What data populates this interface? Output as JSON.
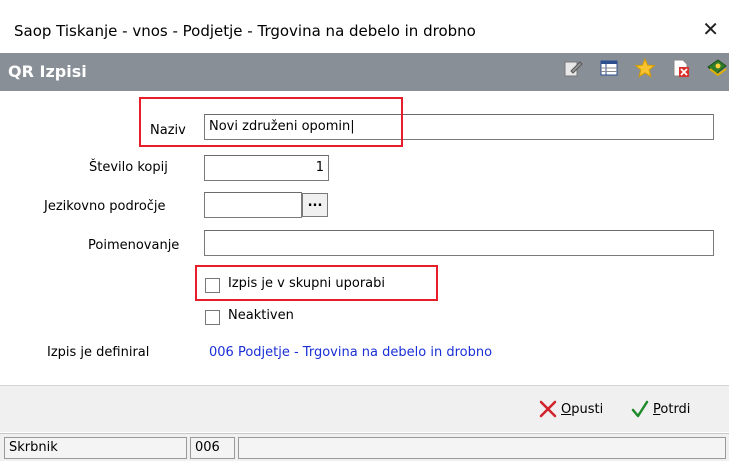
{
  "window": {
    "title": "Saop Tiskanje - vnos - Podjetje - Trgovina na debelo in drobno",
    "close_glyph": "✕"
  },
  "header": {
    "title": "QR Izpisi"
  },
  "toolbar": {
    "icons": [
      "edit-icon",
      "table-icon",
      "star-icon",
      "delete-doc-icon",
      "run-icon"
    ]
  },
  "form": {
    "naziv_label": "Naziv",
    "naziv_value": "Novi združeni opomin",
    "kopij_label": "Število kopij",
    "kopij_value": "1",
    "jezik_label": "Jezikovno področje",
    "jezik_value": "",
    "jezik_button": "...",
    "poimenovanje_label": "Poimenovanje",
    "poimenovanje_value": "",
    "skupni_label": "Izpis je v skupni uporabi",
    "skupni_checked": false,
    "neaktiven_label": "Neaktiven",
    "neaktiven_checked": false,
    "definiral_label": "Izpis je definiral",
    "definiral_value": "006 Podjetje - Trgovina na debelo in drobno"
  },
  "buttons": {
    "opusti_underlined": "O",
    "opusti_rest": "pusti",
    "potrdi_underlined": "P",
    "potrdi_rest": "otrdi"
  },
  "status": {
    "label": "Skrbnik",
    "code": "006",
    "extra": ""
  },
  "colors": {
    "header_bg": "#888f97",
    "link": "#1a2fd6",
    "highlight": "#e81d2a"
  }
}
